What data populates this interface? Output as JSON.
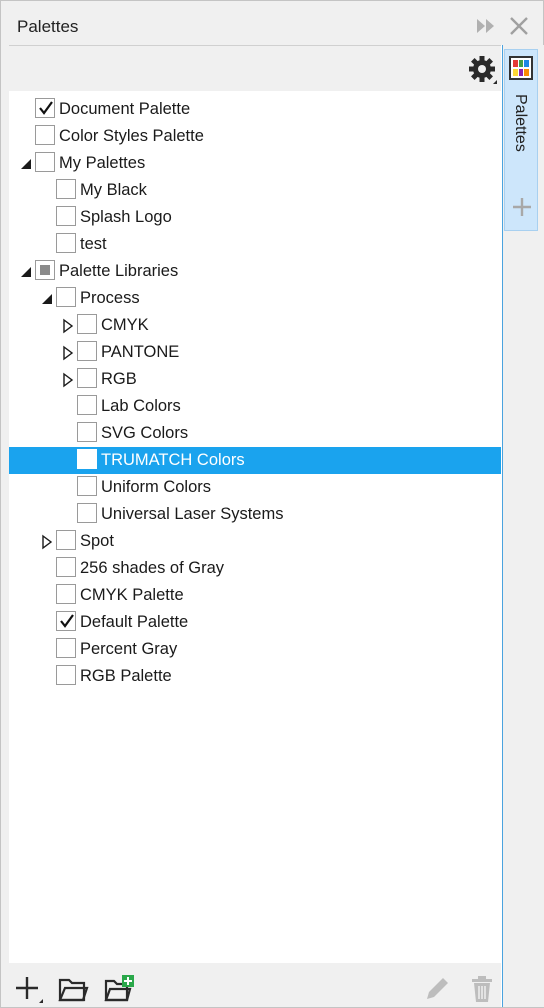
{
  "window": {
    "title": "Palettes"
  },
  "dock": {
    "tab_label": "Palettes"
  },
  "tree": [
    {
      "label": "Document Palette",
      "indent": 0,
      "expander": "none",
      "check": "checked",
      "selected": false
    },
    {
      "label": "Color Styles Palette",
      "indent": 0,
      "expander": "none",
      "check": "unchecked",
      "selected": false
    },
    {
      "label": "My Palettes",
      "indent": 0,
      "expander": "expanded",
      "check": "unchecked",
      "selected": false
    },
    {
      "label": "My Black",
      "indent": 1,
      "expander": "none",
      "check": "unchecked",
      "selected": false
    },
    {
      "label": "Splash Logo",
      "indent": 1,
      "expander": "none",
      "check": "unchecked",
      "selected": false
    },
    {
      "label": "test",
      "indent": 1,
      "expander": "none",
      "check": "unchecked",
      "selected": false
    },
    {
      "label": "Palette Libraries",
      "indent": 0,
      "expander": "expanded",
      "check": "partial",
      "selected": false
    },
    {
      "label": "Process",
      "indent": 1,
      "expander": "expanded",
      "check": "unchecked",
      "selected": false
    },
    {
      "label": "CMYK",
      "indent": 2,
      "expander": "collapsed",
      "check": "unchecked",
      "selected": false
    },
    {
      "label": "PANTONE",
      "indent": 2,
      "expander": "collapsed",
      "check": "unchecked",
      "selected": false
    },
    {
      "label": "RGB",
      "indent": 2,
      "expander": "collapsed",
      "check": "unchecked",
      "selected": false
    },
    {
      "label": "Lab Colors",
      "indent": 2,
      "expander": "none",
      "check": "unchecked",
      "selected": false
    },
    {
      "label": "SVG Colors",
      "indent": 2,
      "expander": "none",
      "check": "unchecked",
      "selected": false
    },
    {
      "label": "TRUMATCH Colors",
      "indent": 2,
      "expander": "none",
      "check": "unchecked",
      "selected": true
    },
    {
      "label": "Uniform Colors",
      "indent": 2,
      "expander": "none",
      "check": "unchecked",
      "selected": false
    },
    {
      "label": "Universal Laser Systems",
      "indent": 2,
      "expander": "none",
      "check": "unchecked",
      "selected": false
    },
    {
      "label": "Spot",
      "indent": 1,
      "expander": "collapsed",
      "check": "unchecked",
      "selected": false
    },
    {
      "label": "256 shades of Gray",
      "indent": 1,
      "expander": "none",
      "check": "unchecked",
      "selected": false
    },
    {
      "label": "CMYK Palette",
      "indent": 1,
      "expander": "none",
      "check": "unchecked",
      "selected": false
    },
    {
      "label": "Default Palette",
      "indent": 1,
      "expander": "none",
      "check": "checked",
      "selected": false
    },
    {
      "label": "Percent Gray",
      "indent": 1,
      "expander": "none",
      "check": "unchecked",
      "selected": false
    },
    {
      "label": "RGB Palette",
      "indent": 1,
      "expander": "none",
      "check": "unchecked",
      "selected": false
    }
  ],
  "colors": {
    "selection": "#1aa3ee",
    "dock_tab": "#cde6fb",
    "accent_border": "#4aa3df",
    "icon_gray": "#3a3a3a",
    "icon_disabled": "#b8b8b8",
    "icon_green": "#2aa84a"
  },
  "icons": {
    "title_bar": [
      "expand-arrows-icon",
      "close-icon"
    ],
    "toolbar": [
      "gear-icon"
    ],
    "bottom": [
      "add-icon",
      "open-folder-icon",
      "new-folder-icon",
      "edit-pencil-icon",
      "trash-icon"
    ],
    "dock": [
      "palette-swatch-icon",
      "dock-add-icon"
    ]
  }
}
